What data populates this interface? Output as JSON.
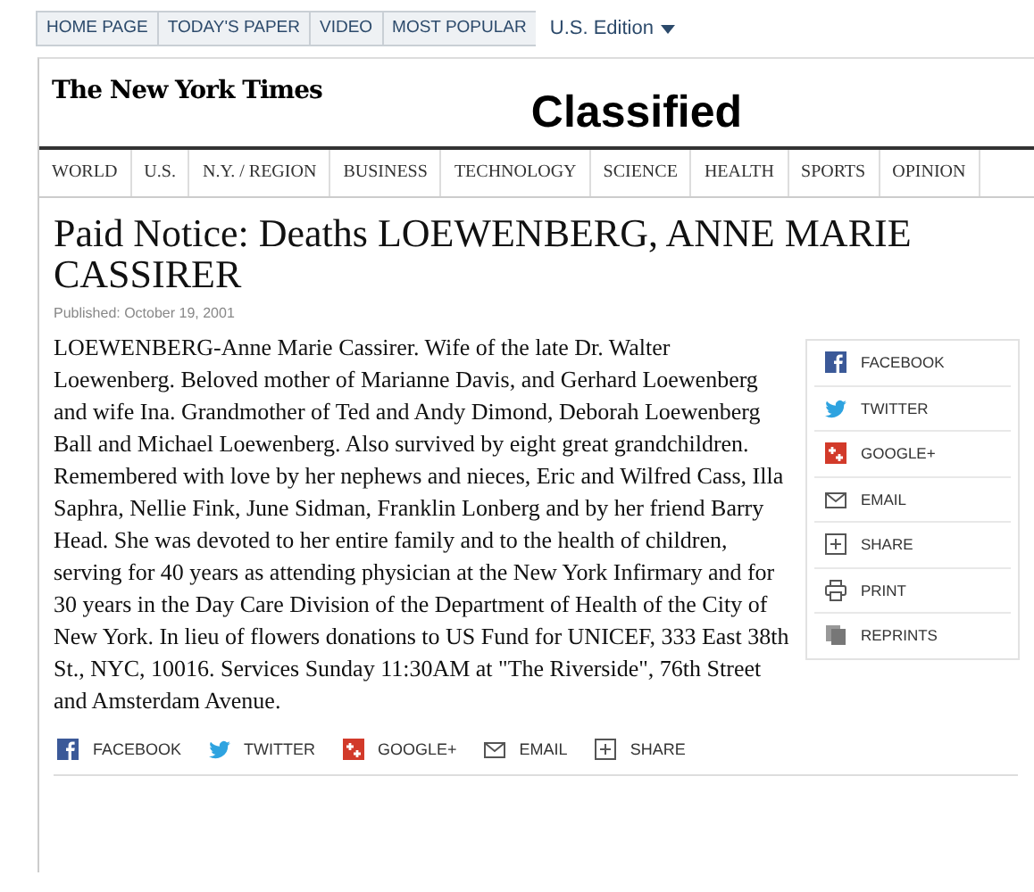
{
  "top_nav": {
    "tabs": [
      "HOME PAGE",
      "TODAY'S PAPER",
      "VIDEO",
      "MOST POPULAR"
    ],
    "edition": "U.S. Edition"
  },
  "masthead": {
    "logo": "The New York Times",
    "section": "Classified"
  },
  "sections": [
    "WORLD",
    "U.S.",
    "N.Y. / REGION",
    "BUSINESS",
    "TECHNOLOGY",
    "SCIENCE",
    "HEALTH",
    "SPORTS",
    "OPINION"
  ],
  "article": {
    "headline": "Paid Notice: Deaths LOEWENBERG, ANNE MARIE CASSIRER",
    "published": "Published: October 19, 2001",
    "body": "LOEWENBERG-Anne Marie Cassirer. Wife of the late Dr. Walter Loewenberg. Beloved mother of Marianne Davis, and Gerhard Loewenberg and wife Ina. Grandmother of Ted and Andy Dimond, Deborah Loewenberg Ball and Michael Loewenberg. Also survived by eight great grandchildren. Remembered with love by her nephews and nieces, Eric and Wilfred Cass, Illa Saphra, Nellie Fink, June Sidman, Franklin Lonberg and by her friend Barry Head. She was devoted to her entire family and to the health of children, serving for 40 years as attending physician at the New York Infirmary and for 30 years in the Day Care Division of the Department of Health of the City of New York. In lieu of flowers donations to US Fund for UNICEF, 333 East 38th St., NYC, 10016. Services Sunday 11:30AM at \"The Riverside\", 76th Street and Amsterdam Avenue."
  },
  "share_box": [
    {
      "kind": "facebook",
      "label": "FACEBOOK"
    },
    {
      "kind": "twitter",
      "label": "TWITTER"
    },
    {
      "kind": "google",
      "label": "GOOGLE+"
    },
    {
      "kind": "email",
      "label": "EMAIL"
    },
    {
      "kind": "share",
      "label": "SHARE"
    },
    {
      "kind": "print",
      "label": "PRINT"
    },
    {
      "kind": "reprints",
      "label": "REPRINTS"
    }
  ],
  "share_bar": [
    {
      "kind": "facebook",
      "label": "FACEBOOK"
    },
    {
      "kind": "twitter",
      "label": "TWITTER"
    },
    {
      "kind": "google",
      "label": "GOOGLE+"
    },
    {
      "kind": "email",
      "label": "EMAIL"
    },
    {
      "kind": "share",
      "label": "SHARE"
    }
  ]
}
